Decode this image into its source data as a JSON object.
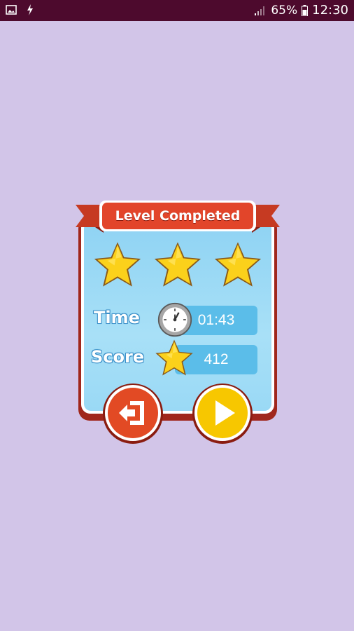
{
  "status_bar": {
    "battery": "65%",
    "time": "12:30",
    "icons": [
      "image-icon",
      "flash-icon",
      "signal-icon",
      "battery-icon"
    ]
  },
  "dialog": {
    "title": "Level Completed",
    "stars_earned": 3,
    "stars_total": 3,
    "time": {
      "label": "Time",
      "value": "01:43",
      "icon": "clock-icon"
    },
    "score": {
      "label": "Score",
      "value": "412",
      "icon": "star-icon"
    },
    "buttons": [
      {
        "name": "exit",
        "icon": "exit-icon"
      },
      {
        "name": "play",
        "icon": "play-icon"
      }
    ]
  },
  "colors": {
    "background": "#d2c5e8",
    "status_bar": "#4d0a2d",
    "ribbon": "#e2452a",
    "panel": "#a8e0f7",
    "star": "#fbd11b",
    "exit_button": "#e24a24",
    "play_button": "#f7c700"
  }
}
